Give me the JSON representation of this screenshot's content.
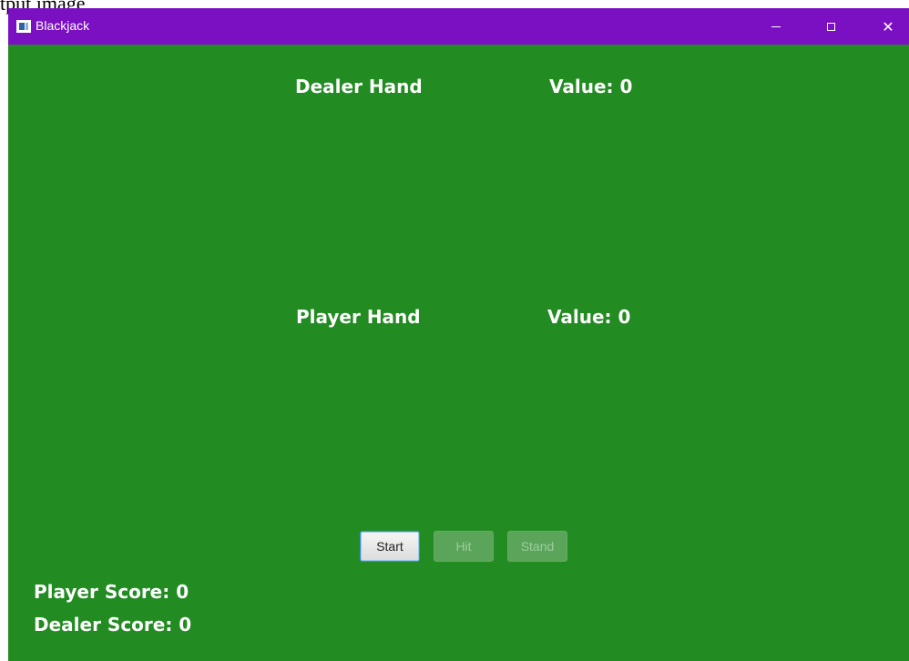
{
  "page_caption": "tput image",
  "window": {
    "title": "Blackjack",
    "icons": {
      "app": "app-window-icon",
      "minimize": "minimize-icon",
      "maximize": "maximize-icon",
      "close": "close-icon"
    },
    "close_glyph": "✕"
  },
  "dealer": {
    "hand_title": "Dealer Hand",
    "value_label": "Value: 0"
  },
  "player": {
    "hand_title": "Player Hand",
    "value_label": "Value: 0"
  },
  "controls": {
    "start_label": "Start",
    "hit_label": "Hit",
    "stand_label": "Stand"
  },
  "scores": {
    "player_score": "Player Score: 0",
    "dealer_score": "Dealer Score: 0"
  },
  "colors": {
    "table": "#228b22",
    "titlebar": "#7b10c3",
    "text": "#ffffff"
  }
}
